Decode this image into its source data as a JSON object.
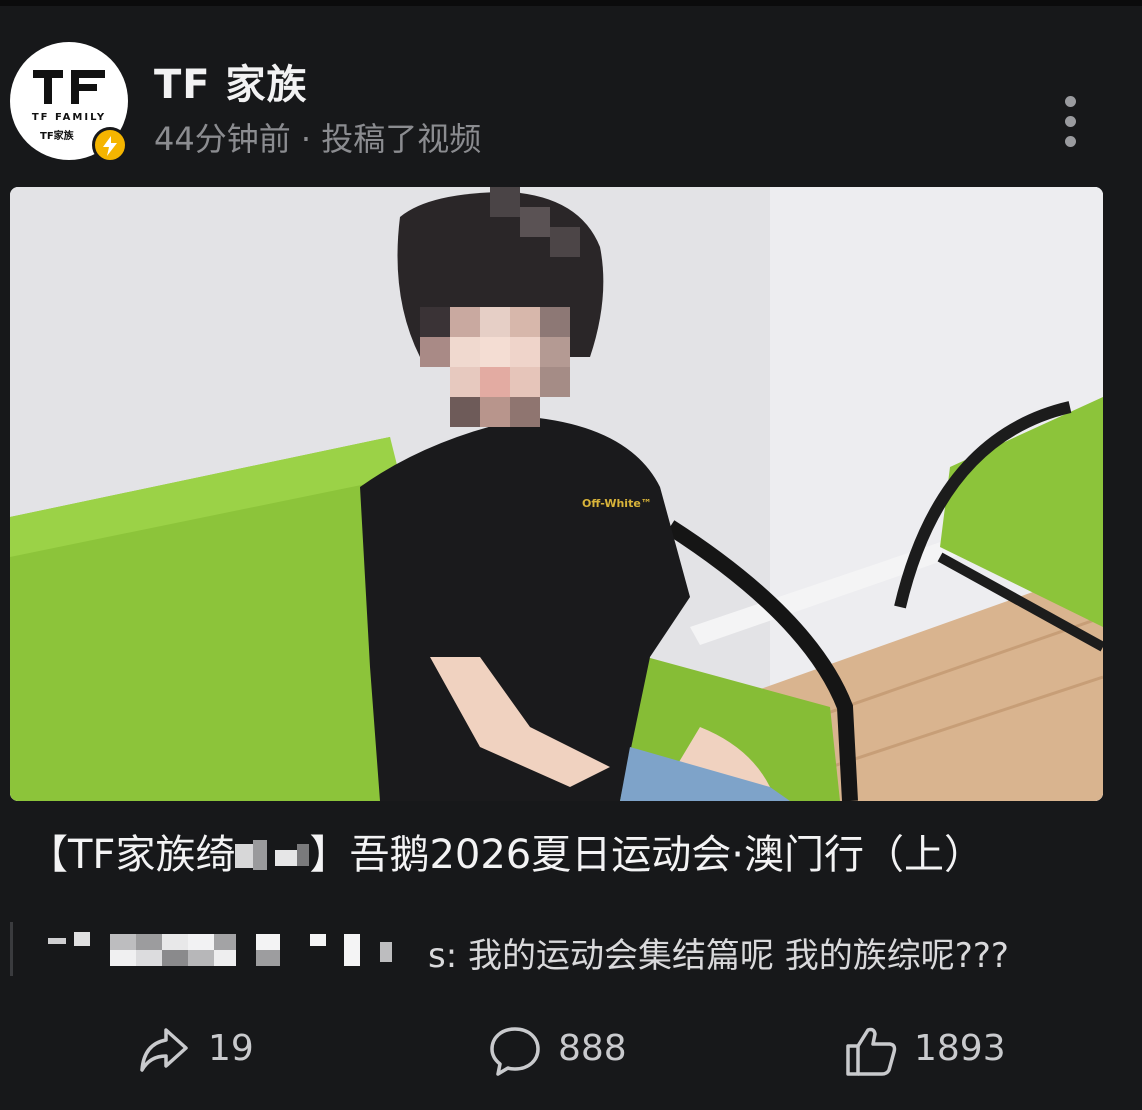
{
  "header": {
    "account_name": "TF 家族",
    "post_meta": "44分钟前 · 投稿了视频",
    "avatar_text_line1": "TF FAMILY",
    "avatar_text_line2": "TF家族",
    "verified_badge_icon": "lightning-bolt-icon",
    "more_icon": "vertical-ellipsis-icon"
  },
  "video": {
    "shirt_logo_text": "Off-White™",
    "title_prefix": "【TF家族绮",
    "title_suffix": "】吾鹅2026夏日运动会·澳门行（上）"
  },
  "comment_preview": {
    "text": "s: 我的运动会集结篇呢 我的族综呢???"
  },
  "actions": {
    "share_count": "19",
    "comment_count": "888",
    "like_count": "1893"
  },
  "colors": {
    "background": "#17181a",
    "badge_yellow": "#f5b500",
    "sofa_green": "#8cc43a",
    "muted_text": "#8b8c90"
  }
}
